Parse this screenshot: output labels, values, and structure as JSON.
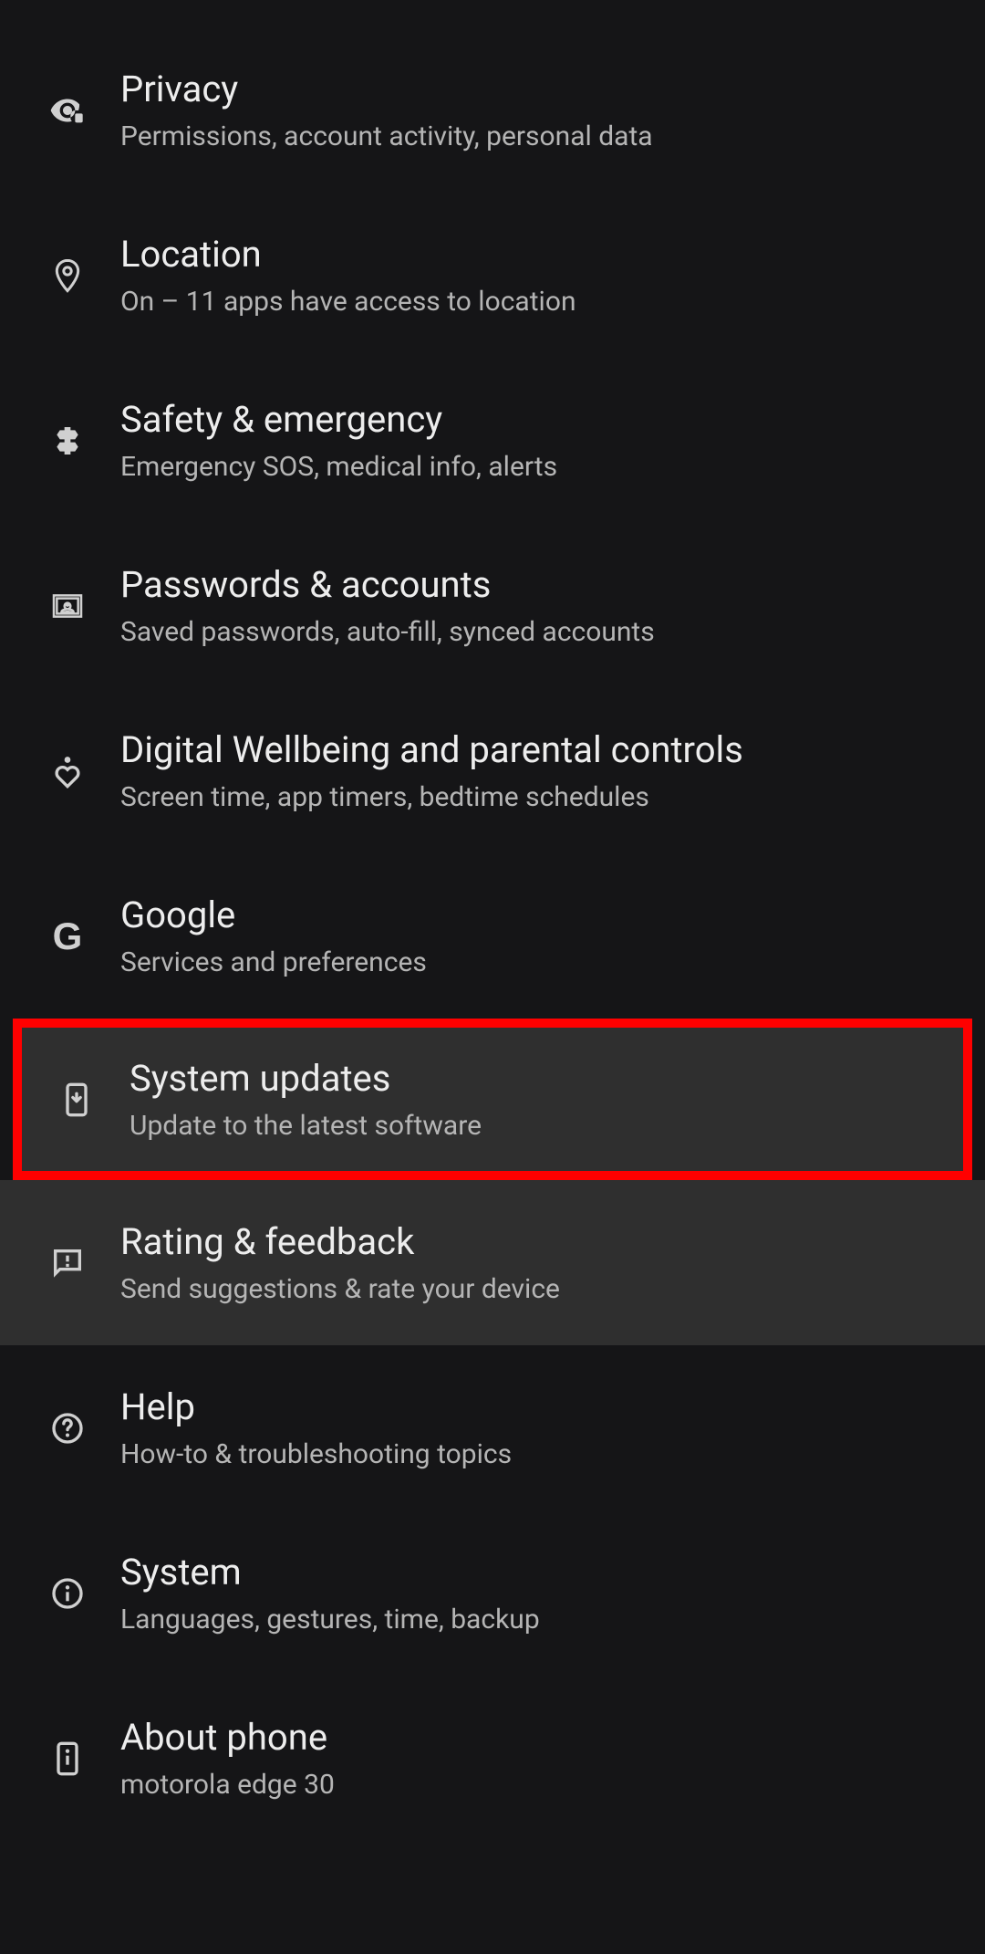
{
  "settings": [
    {
      "icon": "eye-lock-icon",
      "title": "Privacy",
      "subtitle": "Permissions, account activity, personal data",
      "highlighted": false
    },
    {
      "icon": "location-icon",
      "title": "Location",
      "subtitle": "On – 11 apps have access to location",
      "highlighted": false
    },
    {
      "icon": "medical-icon",
      "title": "Safety & emergency",
      "subtitle": "Emergency SOS, medical info, alerts",
      "highlighted": false
    },
    {
      "icon": "account-icon",
      "title": "Passwords & accounts",
      "subtitle": "Saved passwords, auto-fill, synced accounts",
      "highlighted": false
    },
    {
      "icon": "wellbeing-icon",
      "title": "Digital Wellbeing and parental controls",
      "subtitle": "Screen time, app timers, bedtime schedules",
      "highlighted": false
    },
    {
      "icon": "google-icon",
      "title": "Google",
      "subtitle": "Services and preferences",
      "highlighted": false
    },
    {
      "icon": "system-update-icon",
      "title": "System updates",
      "subtitle": "Update to the latest software",
      "highlighted": true,
      "redBorder": true
    },
    {
      "icon": "feedback-icon",
      "title": "Rating & feedback",
      "subtitle": "Send suggestions & rate your device",
      "highlighted": true
    },
    {
      "icon": "help-icon",
      "title": "Help",
      "subtitle": "How-to & troubleshooting topics",
      "highlighted": false
    },
    {
      "icon": "info-icon",
      "title": "System",
      "subtitle": "Languages, gestures, time, backup",
      "highlighted": false
    },
    {
      "icon": "phone-info-icon",
      "title": "About phone",
      "subtitle": "motorola edge 30",
      "highlighted": false
    }
  ]
}
